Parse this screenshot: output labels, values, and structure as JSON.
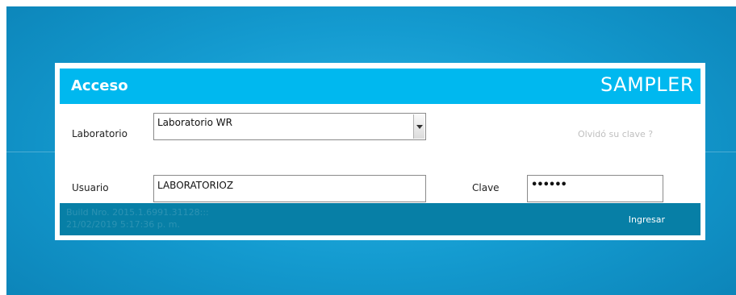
{
  "header": {
    "title": "Acceso",
    "brand": "SAMPLER"
  },
  "form": {
    "laboratorio_label": "Laboratorio",
    "laboratorio_value": "Laboratorio WR",
    "forgot_label": "Olvidó su clave ?",
    "usuario_label": "Usuario",
    "usuario_value": "LABORATORIOZ",
    "clave_label": "Clave",
    "clave_mask": "••••••"
  },
  "footer": {
    "build_line1": "Build Nro. 2015.1.6991.31128:::",
    "build_line2": "21/02/2019 5:17:36 p. m.",
    "submit_label": "Ingresar"
  },
  "colors": {
    "header_bg": "#00b8ef",
    "footer_bg": "#077fa6",
    "background": "#149bd0"
  },
  "icons": {
    "dropdown": "chevron-down-icon"
  }
}
